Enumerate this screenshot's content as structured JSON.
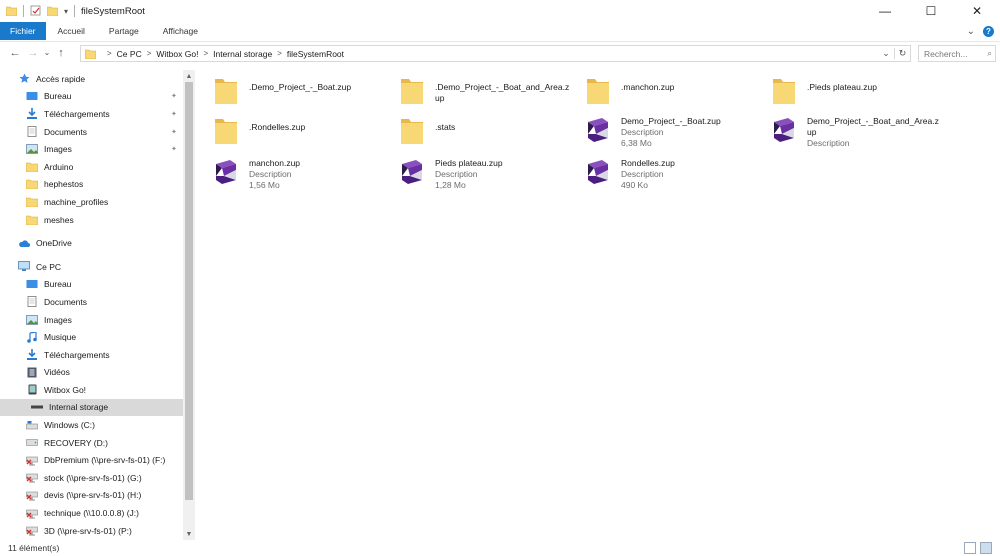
{
  "window": {
    "title": "fileSystemRoot",
    "minimize_glyph": "—",
    "maximize_glyph": "☐",
    "close_glyph": "✕"
  },
  "ribbon": {
    "tabs": [
      "Fichier",
      "Accueil",
      "Partage",
      "Affichage"
    ],
    "expand_glyph": "⌄",
    "help_glyph": "?"
  },
  "nav": {
    "back": "←",
    "forward": "→",
    "recent": "⌄",
    "up": "↑",
    "breadcrumb": [
      "Ce PC",
      "Witbox Go!",
      "Internal storage",
      "fileSystemRoot"
    ],
    "separator": ">",
    "dropdown_glyph": "⌄",
    "refresh_glyph": "↻",
    "search_placeholder": "Recherch...",
    "search_glyph": "⌕"
  },
  "sidebar": {
    "quick_access": "Accès rapide",
    "pinned": [
      "Bureau",
      "Téléchargements",
      "Documents",
      "Images"
    ],
    "folders": [
      "Arduino",
      "hephestos",
      "machine_profiles",
      "meshes"
    ],
    "onedrive": "OneDrive",
    "this_pc": "Ce PC",
    "pc_items": [
      "Bureau",
      "Documents",
      "Images",
      "Musique",
      "Téléchargements",
      "Vidéos"
    ],
    "device": "Witbox Go!",
    "device_child": "Internal storage",
    "drives": [
      "Windows (C:)",
      "RECOVERY (D:)",
      "DbPremium (\\\\pre-srv-fs-01) (F:)",
      "stock (\\\\pre-srv-fs-01) (G:)",
      "devis (\\\\pre-srv-fs-01) (H:)",
      "technique (\\\\10.0.0.8) (J:)",
      "3D (\\\\pre-srv-fs-01) (P:)"
    ],
    "pin_glyph": "📌"
  },
  "files": [
    {
      "name": ".Demo_Project_-_Boat.zup",
      "kind": "folder",
      "desc": "",
      "size": ""
    },
    {
      "name": ".Demo_Project_-_Boat_and_Area.zup",
      "kind": "folder",
      "desc": "",
      "size": ""
    },
    {
      "name": ".manchon.zup",
      "kind": "folder",
      "desc": "",
      "size": ""
    },
    {
      "name": ".Pieds plateau.zup",
      "kind": "folder",
      "desc": "",
      "size": ""
    },
    {
      "name": ".Rondelles.zup",
      "kind": "folder",
      "desc": "",
      "size": ""
    },
    {
      "name": ".stats",
      "kind": "folder",
      "desc": "",
      "size": ""
    },
    {
      "name": "Demo_Project_-_Boat.zup",
      "kind": "zup",
      "desc": "Description",
      "size": "6,38 Mo"
    },
    {
      "name": "Demo_Project_-_Boat_and_Area.zup",
      "kind": "zup",
      "desc": "Description",
      "size": ""
    },
    {
      "name": "manchon.zup",
      "kind": "zup",
      "desc": "Description",
      "size": "1,56 Mo"
    },
    {
      "name": "Pieds plateau.zup",
      "kind": "zup",
      "desc": "Description",
      "size": "1,28 Mo"
    },
    {
      "name": "Rondelles.zup",
      "kind": "zup",
      "desc": "Description",
      "size": "490 Ko"
    }
  ],
  "status": {
    "count": "11 élément(s)"
  },
  "colors": {
    "accent": "#1979ca",
    "folder": "#f8d775",
    "zup_primary": "#6a2fa0",
    "zup_secondary": "#2b1c4a"
  }
}
